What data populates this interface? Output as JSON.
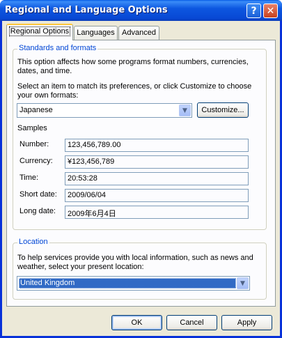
{
  "window": {
    "title": "Regional and Language Options",
    "help_glyph": "?",
    "close_glyph": "✕"
  },
  "tabs": [
    {
      "label": "Regional Options",
      "active": true
    },
    {
      "label": "Languages",
      "active": false
    },
    {
      "label": "Advanced",
      "active": false
    }
  ],
  "standards": {
    "legend": "Standards and formats",
    "desc_line1": "This option affects how some programs format numbers, currencies,",
    "desc_line2": "dates, and time.",
    "select_line1": "Select an item to match its preferences, or click Customize to choose",
    "select_line2": "your own formats:",
    "selected_locale": "Japanese",
    "customize_label": "Customize...",
    "samples_label": "Samples",
    "samples": [
      {
        "label": "Number:",
        "value": "123,456,789.00"
      },
      {
        "label": "Currency:",
        "value": "¥123,456,789"
      },
      {
        "label": "Time:",
        "value": "20:53:28"
      },
      {
        "label": "Short date:",
        "value": "2009/06/04"
      },
      {
        "label": "Long date:",
        "value": "2009年6月4日"
      }
    ]
  },
  "location": {
    "legend": "Location",
    "desc_line1": "To help services provide you with local information, such as news and",
    "desc_line2": "weather, select your present location:",
    "selected_location": "United Kingdom"
  },
  "buttons": {
    "ok": "OK",
    "cancel": "Cancel",
    "apply": "Apply"
  },
  "colors": {
    "titlebar": "#0a5ee6",
    "face": "#ece9d8",
    "group_legend": "#0046d5",
    "selection": "#316ac5",
    "active_tab_accent": "#ffc83c"
  }
}
